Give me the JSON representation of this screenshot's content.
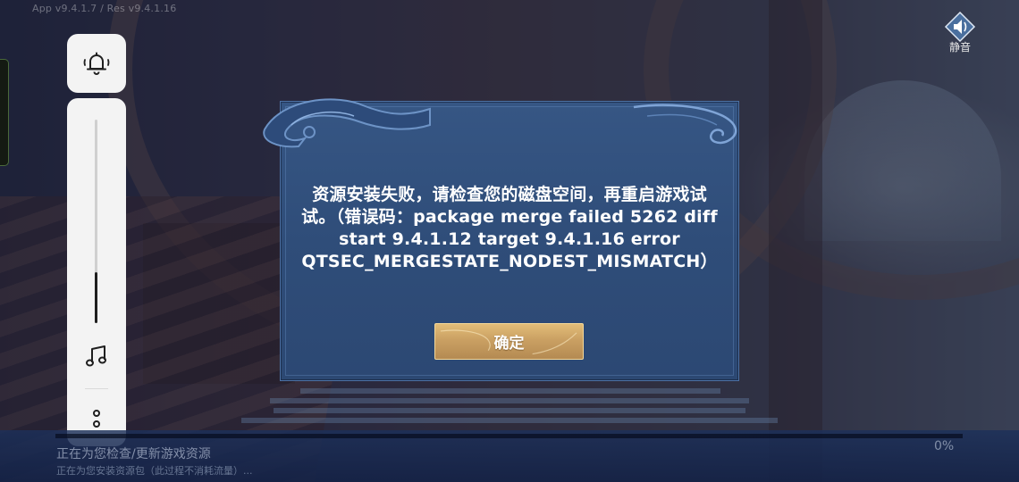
{
  "version": {
    "text": "App v9.4.1.7 / Res v9.4.1.16"
  },
  "panel": {
    "volume_level": 0.25,
    "icons": [
      "bell-icon",
      "music-note-icon",
      "more-vertical-icon"
    ]
  },
  "top_right": {
    "sound_label": "静音",
    "icon": "speaker-icon"
  },
  "dialog": {
    "message": "资源安装失败，请检查您的磁盘空间，再重启游戏试试。（错误码：package merge failed 5262 diff start 9.4.1.12 target 9.4.1.16 error QTSEC_MERGESTATE_NODEST_MISMATCH）",
    "confirm_label": "确定"
  },
  "bottom": {
    "status_main": "正在为您检查/更新游戏资源",
    "status_sub": "正在为您安装资源包（此过程不消耗流量）...",
    "progress_percent": 0,
    "percent_label": "0%"
  },
  "colors": {
    "dialog_bg": "#2f4d79",
    "button_gold": "#caa063",
    "panel_bg": "#f3f3f3"
  }
}
